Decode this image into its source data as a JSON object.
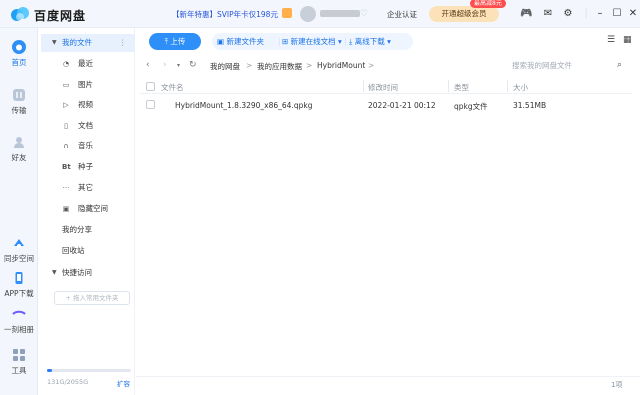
{
  "app": {
    "title": "百度网盘",
    "promo": "【新年特惠】SVIP年卡仅198元",
    "verify": "企业认证",
    "vip_button": "开通超级会员",
    "vip_tag": "最高减8元"
  },
  "rail": [
    {
      "label": "首页",
      "icon": "home-cloud-icon",
      "active": true
    },
    {
      "label": "传输",
      "icon": "transfer-icon",
      "active": false
    },
    {
      "label": "好友",
      "icon": "friends-icon",
      "active": false
    },
    {
      "label": "同步空间",
      "icon": "sync-icon",
      "active": false
    },
    {
      "label": "APP下载",
      "icon": "phone-icon",
      "active": false
    },
    {
      "label": "一刻相册",
      "icon": "album-icon",
      "active": false
    },
    {
      "label": "工具",
      "icon": "tools-icon",
      "active": false
    }
  ],
  "side": {
    "my_files": "我的文件",
    "more_dots": "⋮",
    "items": [
      {
        "label": "最近",
        "icon": "clock-icon"
      },
      {
        "label": "图片",
        "icon": "image-icon"
      },
      {
        "label": "视频",
        "icon": "video-icon"
      },
      {
        "label": "文档",
        "icon": "document-icon"
      },
      {
        "label": "音乐",
        "icon": "music-icon"
      },
      {
        "label": "种子",
        "icon": "torrent-icon"
      },
      {
        "label": "其它",
        "icon": "other-icon"
      },
      {
        "label": "隐藏空间",
        "icon": "lock-icon"
      }
    ],
    "my_share": "我的分享",
    "recycle": "回收站",
    "quick_access": "快捷访问",
    "add_folder": "+ 拖入常用文件夹",
    "storage": "131G/2055G",
    "expand": "扩容",
    "storage_used_fraction": 0.064
  },
  "toolbar": {
    "upload": "上传",
    "new_folder": "新建文件夹",
    "new_doc": "新建在线文档",
    "offline": "离线下载"
  },
  "breadcrumb": [
    "我的网盘",
    "我的应用数据",
    "HybridMount"
  ],
  "search_placeholder": "搜索我的网盘文件",
  "table": {
    "headers": [
      "文件名",
      "修改时间",
      "类型",
      "大小"
    ],
    "rows": [
      {
        "name": "HybridMount_1.8.3290_x86_64.qpkg",
        "modified": "2022-01-21 00:12",
        "type": "qpkg文件",
        "size": "31.51MB"
      }
    ]
  },
  "footer": {
    "count": "1项"
  }
}
